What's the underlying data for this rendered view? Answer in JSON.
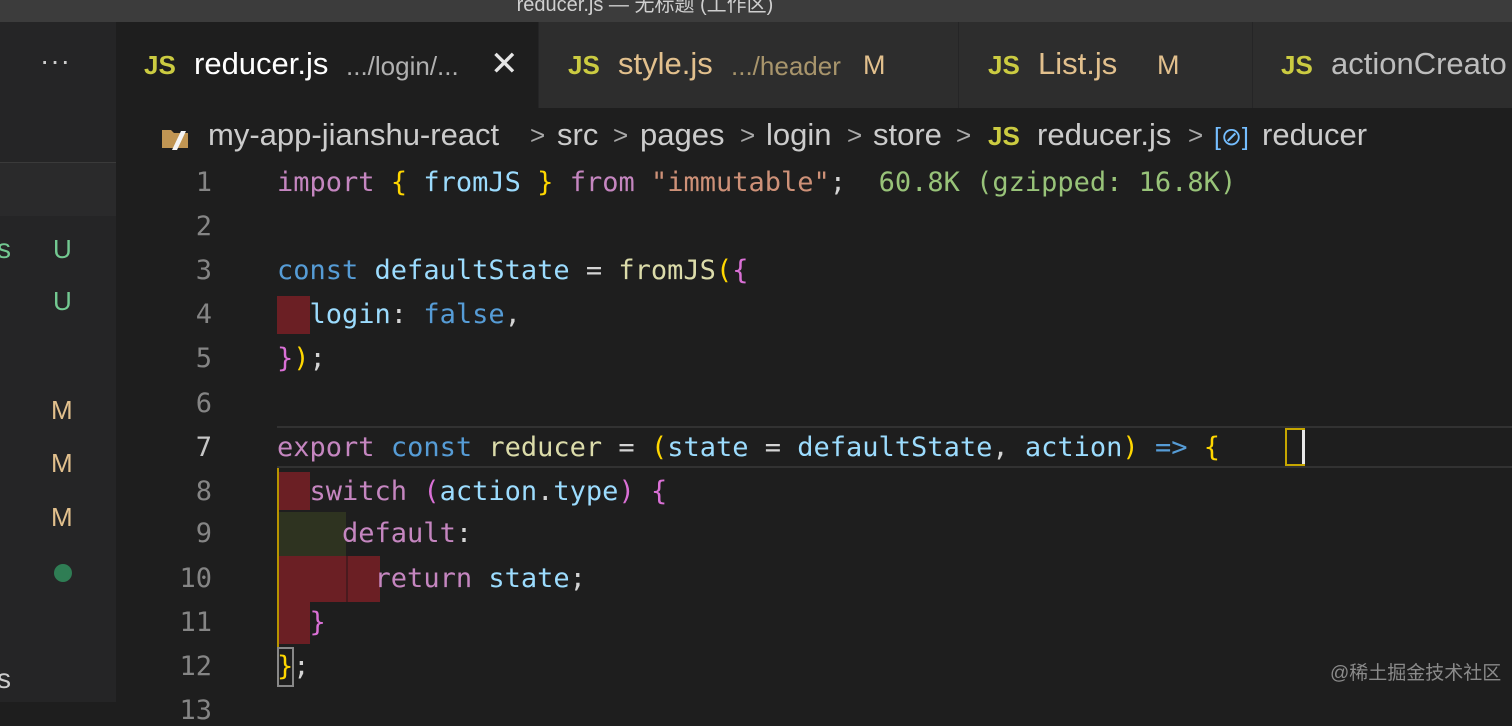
{
  "window": {
    "title": "reducer.js — 无标题 (工作区)"
  },
  "sidebar": {
    "more_label": "···",
    "badges": [
      {
        "frag": "s",
        "status": "U"
      },
      {
        "frag": "",
        "status": "U"
      },
      {
        "frag": "",
        "status": "M"
      },
      {
        "frag": "",
        "status": "M"
      },
      {
        "frag": "",
        "status": "M"
      },
      {
        "frag": "s",
        "status": ""
      }
    ]
  },
  "tabs": [
    {
      "icon": "JS",
      "name": "reducer.js",
      "path": ".../login/...",
      "active": true,
      "close": "✕"
    },
    {
      "icon": "JS",
      "name": "style.js",
      "path": ".../header",
      "status": "M"
    },
    {
      "icon": "JS",
      "name": "List.js",
      "status": "M"
    },
    {
      "icon": "JS",
      "name": "actionCreato"
    }
  ],
  "breadcrumb": {
    "items": [
      "my-app-jianshu-react",
      "src",
      "pages",
      "login",
      "store",
      "reducer.js",
      "reducer"
    ],
    "separator": ">",
    "js_icon": "JS",
    "symbol_icon": "[⊘]"
  },
  "editor": {
    "line_numbers": [
      "1",
      "2",
      "3",
      "4",
      "5",
      "6",
      "7",
      "8",
      "9",
      "10",
      "11",
      "12",
      "13"
    ],
    "active_line": "7",
    "lines": [
      [
        [
          "kw",
          "import"
        ],
        [
          "pu",
          " "
        ],
        [
          "b1",
          "{"
        ],
        [
          "pu",
          " "
        ],
        [
          "vr",
          "fromJS"
        ],
        [
          "pu",
          " "
        ],
        [
          "b1",
          "}"
        ],
        [
          "pu",
          " "
        ],
        [
          "kw",
          "from"
        ],
        [
          "pu",
          " "
        ],
        [
          "st",
          "\"immutable\""
        ],
        [
          "pu",
          ";"
        ],
        [
          "pu",
          "  "
        ],
        [
          "hint",
          "60.8K (gzipped: 16.8K)"
        ]
      ],
      [],
      [
        [
          "kb",
          "const"
        ],
        [
          "pu",
          " "
        ],
        [
          "vr",
          "defaultState"
        ],
        [
          "pu",
          " = "
        ],
        [
          "fn",
          "fromJS"
        ],
        [
          "b1",
          "("
        ],
        [
          "b2",
          "{"
        ]
      ],
      [
        [
          "pu",
          "  "
        ],
        [
          "vr",
          "login"
        ],
        [
          "pu",
          ": "
        ],
        [
          "kb",
          "false"
        ],
        [
          "pu",
          ","
        ]
      ],
      [
        [
          "b2",
          "}"
        ],
        [
          "b1",
          ")"
        ],
        [
          "pu",
          ";"
        ]
      ],
      [],
      [
        [
          "kw",
          "export"
        ],
        [
          "pu",
          " "
        ],
        [
          "kb",
          "const"
        ],
        [
          "pu",
          " "
        ],
        [
          "fn",
          "reducer"
        ],
        [
          "pu",
          " = "
        ],
        [
          "b1",
          "("
        ],
        [
          "vr",
          "state"
        ],
        [
          "pu",
          " = "
        ],
        [
          "vr",
          "defaultState"
        ],
        [
          "pu",
          ", "
        ],
        [
          "vr",
          "action"
        ],
        [
          "b1",
          ")"
        ],
        [
          "pu",
          " "
        ],
        [
          "kb",
          "=>"
        ],
        [
          "pu",
          " "
        ],
        [
          "b1",
          "{"
        ]
      ],
      [
        [
          "pu",
          "  "
        ],
        [
          "kw",
          "switch"
        ],
        [
          "pu",
          " "
        ],
        [
          "b2",
          "("
        ],
        [
          "vr",
          "action"
        ],
        [
          "pu",
          "."
        ],
        [
          "vr",
          "type"
        ],
        [
          "b2",
          ")"
        ],
        [
          "pu",
          " "
        ],
        [
          "b2",
          "{"
        ]
      ],
      [
        [
          "pu",
          "    "
        ],
        [
          "kw",
          "default"
        ],
        [
          "pu",
          ":"
        ]
      ],
      [
        [
          "pu",
          "      "
        ],
        [
          "kw",
          "return"
        ],
        [
          "pu",
          " "
        ],
        [
          "vr",
          "state"
        ],
        [
          "pu",
          ";"
        ]
      ],
      [
        [
          "pu",
          "  "
        ],
        [
          "b2",
          "}"
        ]
      ],
      [
        [
          "b1",
          "}"
        ],
        [
          "pu",
          ";"
        ]
      ],
      []
    ]
  },
  "watermark": "@稀土掘金技术社区"
}
